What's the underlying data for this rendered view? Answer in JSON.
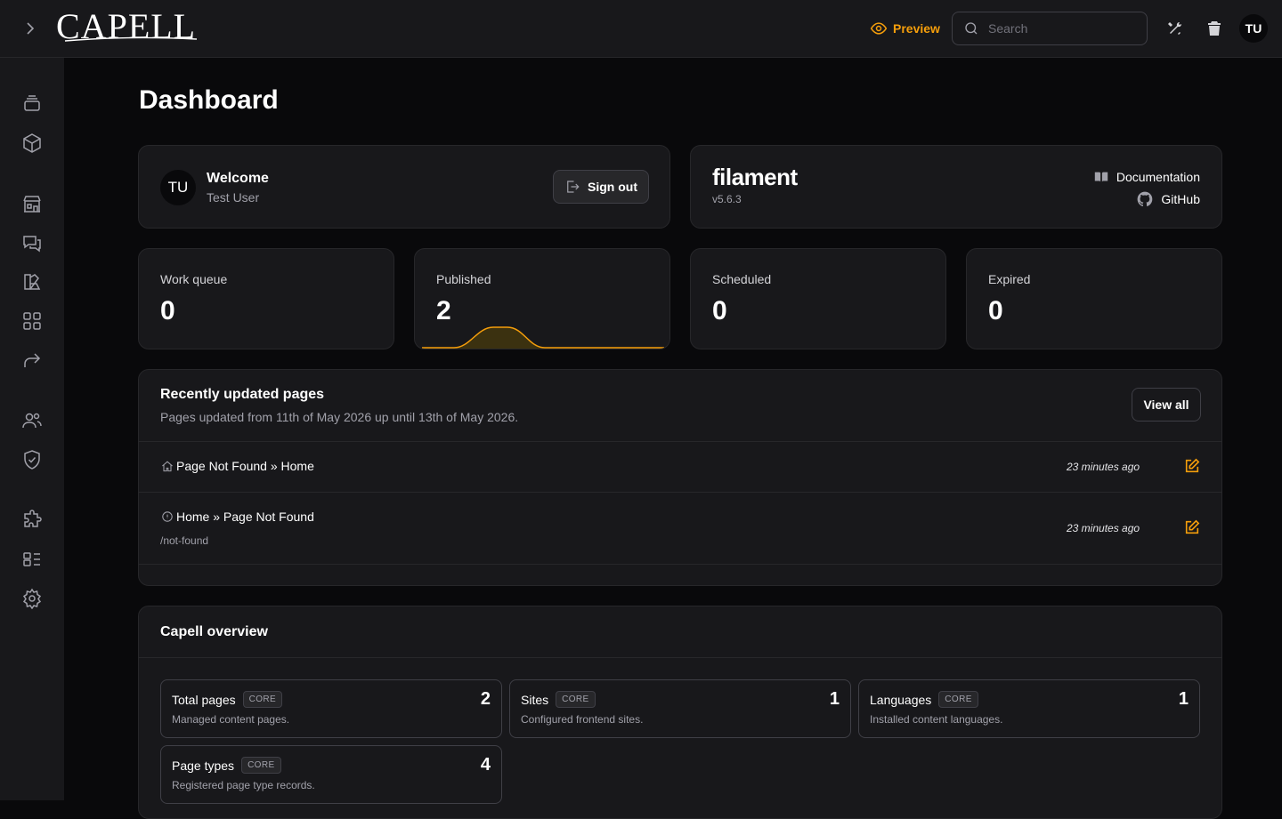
{
  "app": {
    "logo": "CAPELL"
  },
  "header": {
    "preview_label": "Preview",
    "search_placeholder": "Search",
    "user_initials": "TU",
    "accent_color": "#f59e0b"
  },
  "sidebar": {
    "icons": [
      "layers-icon",
      "cube-icon",
      "building-icon",
      "chat-icon",
      "theme-icon",
      "grid-icon",
      "redirect-icon",
      "users-icon",
      "shield-check-icon",
      "puzzle-icon",
      "layout-icon",
      "gear-icon"
    ]
  },
  "page": {
    "title": "Dashboard"
  },
  "welcome": {
    "initials": "TU",
    "title": "Welcome",
    "user": "Test User",
    "sign_out": "Sign out"
  },
  "filament": {
    "logo": "filament",
    "version": "v5.6.3",
    "documentation": "Documentation",
    "github": "GitHub"
  },
  "stats": [
    {
      "label": "Work queue",
      "value": "0"
    },
    {
      "label": "Published",
      "value": "2"
    },
    {
      "label": "Scheduled",
      "value": "0"
    },
    {
      "label": "Expired",
      "value": "0"
    }
  ],
  "recent": {
    "title": "Recently updated pages",
    "subtitle": "Pages updated from 11th of May 2026 up until 13th of May 2026.",
    "view_all": "View all",
    "rows": [
      {
        "icon": "home-icon",
        "name": "Page Not Found » Home",
        "path": "",
        "time": "23 minutes ago"
      },
      {
        "icon": "info-icon",
        "name": "Home » Page Not Found",
        "path": "/not-found",
        "time": "23 minutes ago"
      }
    ]
  },
  "overview": {
    "title": "Capell overview",
    "items": [
      {
        "name": "Total pages",
        "badge": "CORE",
        "desc": "Managed content pages.",
        "count": "2"
      },
      {
        "name": "Sites",
        "badge": "CORE",
        "desc": "Configured frontend sites.",
        "count": "1"
      },
      {
        "name": "Languages",
        "badge": "CORE",
        "desc": "Installed content languages.",
        "count": "1"
      },
      {
        "name": "Page types",
        "badge": "CORE",
        "desc": "Registered page type records.",
        "count": "4"
      }
    ]
  }
}
